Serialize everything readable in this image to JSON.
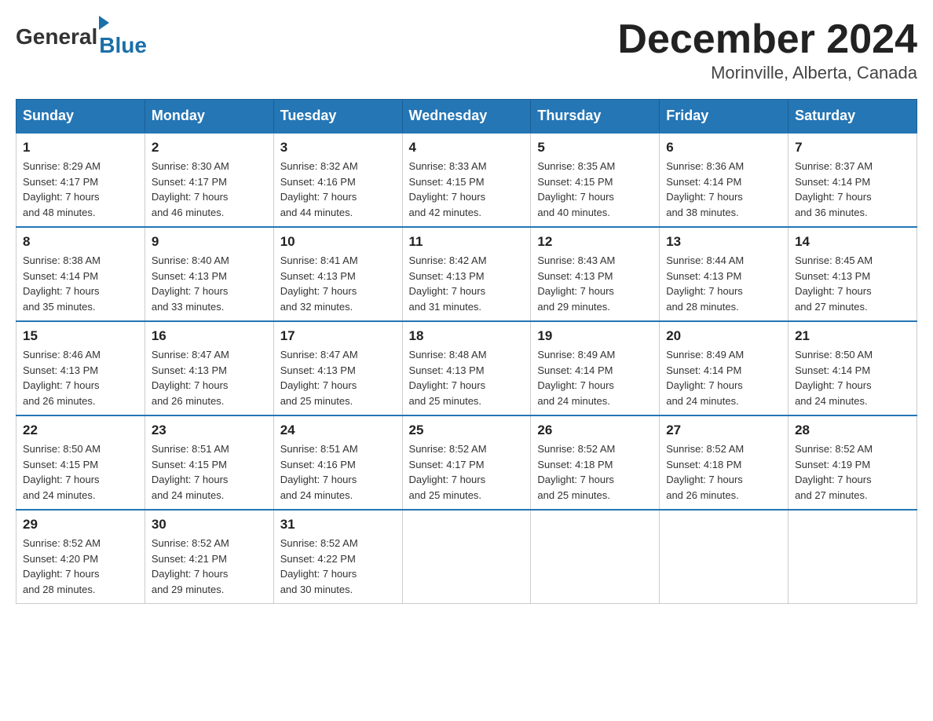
{
  "header": {
    "logo_general": "General",
    "logo_blue": "Blue",
    "month_title": "December 2024",
    "location": "Morinville, Alberta, Canada"
  },
  "days_of_week": [
    "Sunday",
    "Monday",
    "Tuesday",
    "Wednesday",
    "Thursday",
    "Friday",
    "Saturday"
  ],
  "weeks": [
    [
      {
        "day": "1",
        "sunrise": "8:29 AM",
        "sunset": "4:17 PM",
        "daylight": "7 hours and 48 minutes."
      },
      {
        "day": "2",
        "sunrise": "8:30 AM",
        "sunset": "4:17 PM",
        "daylight": "7 hours and 46 minutes."
      },
      {
        "day": "3",
        "sunrise": "8:32 AM",
        "sunset": "4:16 PM",
        "daylight": "7 hours and 44 minutes."
      },
      {
        "day": "4",
        "sunrise": "8:33 AM",
        "sunset": "4:15 PM",
        "daylight": "7 hours and 42 minutes."
      },
      {
        "day": "5",
        "sunrise": "8:35 AM",
        "sunset": "4:15 PM",
        "daylight": "7 hours and 40 minutes."
      },
      {
        "day": "6",
        "sunrise": "8:36 AM",
        "sunset": "4:14 PM",
        "daylight": "7 hours and 38 minutes."
      },
      {
        "day": "7",
        "sunrise": "8:37 AM",
        "sunset": "4:14 PM",
        "daylight": "7 hours and 36 minutes."
      }
    ],
    [
      {
        "day": "8",
        "sunrise": "8:38 AM",
        "sunset": "4:14 PM",
        "daylight": "7 hours and 35 minutes."
      },
      {
        "day": "9",
        "sunrise": "8:40 AM",
        "sunset": "4:13 PM",
        "daylight": "7 hours and 33 minutes."
      },
      {
        "day": "10",
        "sunrise": "8:41 AM",
        "sunset": "4:13 PM",
        "daylight": "7 hours and 32 minutes."
      },
      {
        "day": "11",
        "sunrise": "8:42 AM",
        "sunset": "4:13 PM",
        "daylight": "7 hours and 31 minutes."
      },
      {
        "day": "12",
        "sunrise": "8:43 AM",
        "sunset": "4:13 PM",
        "daylight": "7 hours and 29 minutes."
      },
      {
        "day": "13",
        "sunrise": "8:44 AM",
        "sunset": "4:13 PM",
        "daylight": "7 hours and 28 minutes."
      },
      {
        "day": "14",
        "sunrise": "8:45 AM",
        "sunset": "4:13 PM",
        "daylight": "7 hours and 27 minutes."
      }
    ],
    [
      {
        "day": "15",
        "sunrise": "8:46 AM",
        "sunset": "4:13 PM",
        "daylight": "7 hours and 26 minutes."
      },
      {
        "day": "16",
        "sunrise": "8:47 AM",
        "sunset": "4:13 PM",
        "daylight": "7 hours and 26 minutes."
      },
      {
        "day": "17",
        "sunrise": "8:47 AM",
        "sunset": "4:13 PM",
        "daylight": "7 hours and 25 minutes."
      },
      {
        "day": "18",
        "sunrise": "8:48 AM",
        "sunset": "4:13 PM",
        "daylight": "7 hours and 25 minutes."
      },
      {
        "day": "19",
        "sunrise": "8:49 AM",
        "sunset": "4:14 PM",
        "daylight": "7 hours and 24 minutes."
      },
      {
        "day": "20",
        "sunrise": "8:49 AM",
        "sunset": "4:14 PM",
        "daylight": "7 hours and 24 minutes."
      },
      {
        "day": "21",
        "sunrise": "8:50 AM",
        "sunset": "4:14 PM",
        "daylight": "7 hours and 24 minutes."
      }
    ],
    [
      {
        "day": "22",
        "sunrise": "8:50 AM",
        "sunset": "4:15 PM",
        "daylight": "7 hours and 24 minutes."
      },
      {
        "day": "23",
        "sunrise": "8:51 AM",
        "sunset": "4:15 PM",
        "daylight": "7 hours and 24 minutes."
      },
      {
        "day": "24",
        "sunrise": "8:51 AM",
        "sunset": "4:16 PM",
        "daylight": "7 hours and 24 minutes."
      },
      {
        "day": "25",
        "sunrise": "8:52 AM",
        "sunset": "4:17 PM",
        "daylight": "7 hours and 25 minutes."
      },
      {
        "day": "26",
        "sunrise": "8:52 AM",
        "sunset": "4:18 PM",
        "daylight": "7 hours and 25 minutes."
      },
      {
        "day": "27",
        "sunrise": "8:52 AM",
        "sunset": "4:18 PM",
        "daylight": "7 hours and 26 minutes."
      },
      {
        "day": "28",
        "sunrise": "8:52 AM",
        "sunset": "4:19 PM",
        "daylight": "7 hours and 27 minutes."
      }
    ],
    [
      {
        "day": "29",
        "sunrise": "8:52 AM",
        "sunset": "4:20 PM",
        "daylight": "7 hours and 28 minutes."
      },
      {
        "day": "30",
        "sunrise": "8:52 AM",
        "sunset": "4:21 PM",
        "daylight": "7 hours and 29 minutes."
      },
      {
        "day": "31",
        "sunrise": "8:52 AM",
        "sunset": "4:22 PM",
        "daylight": "7 hours and 30 minutes."
      },
      null,
      null,
      null,
      null
    ]
  ],
  "labels": {
    "sunrise": "Sunrise:",
    "sunset": "Sunset:",
    "daylight": "Daylight:"
  }
}
